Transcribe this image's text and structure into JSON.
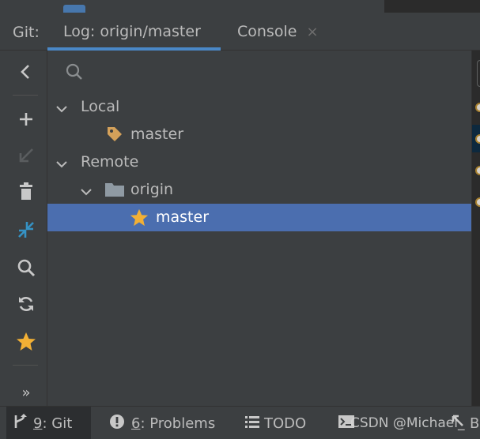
{
  "header": {
    "title": "Git:",
    "tabs": [
      {
        "label": "Log: origin/master",
        "active": true
      },
      {
        "label": "Console",
        "close": "×"
      }
    ]
  },
  "search": {
    "placeholder": ""
  },
  "tree": {
    "local": {
      "label": "Local",
      "expanded": true,
      "branches": [
        {
          "label": "master",
          "icon": "tag-icon"
        }
      ]
    },
    "remote": {
      "label": "Remote",
      "expanded": true,
      "groups": [
        {
          "label": "origin",
          "expanded": true,
          "branches": [
            {
              "label": "master",
              "icon": "star-icon",
              "selected": true
            }
          ]
        }
      ]
    }
  },
  "toolbar": {
    "icons": [
      "back-arrow-icon",
      "add-icon",
      "checkout-icon",
      "delete-icon",
      "compare-icon",
      "search-icon",
      "refresh-icon",
      "favorite-star-icon",
      "more-icon"
    ],
    "more_label": "»"
  },
  "bottom": {
    "items": [
      {
        "key": "9",
        "label": ": Git",
        "icon": "git-branch-icon",
        "active": true
      },
      {
        "key": "6",
        "label": ": Problems",
        "icon": "problems-icon"
      },
      {
        "label": "TODO",
        "icon": "todo-icon"
      },
      {
        "label": "Terminal",
        "icon": "terminal-icon"
      },
      {
        "label": "B",
        "icon": "build-icon"
      }
    ],
    "watermark": "CSDN @Michael_"
  },
  "colors": {
    "background": "#3c3f41",
    "selection": "#4b6eaf",
    "tab_underline": "#4a88c7",
    "star": "#f2b035",
    "tag": "#d4a15a",
    "compare": "#3592c4"
  }
}
